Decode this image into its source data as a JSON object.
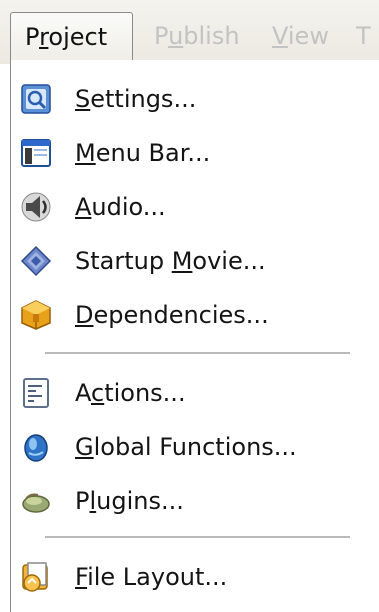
{
  "menubar": {
    "tabs": [
      {
        "label": "Project",
        "active": true
      },
      {
        "label": "Publish",
        "active": false
      },
      {
        "label": "View",
        "active": false
      },
      {
        "label": "T",
        "active": false
      }
    ]
  },
  "dropdown": {
    "items": [
      {
        "label": "Settings...",
        "mnemonic": "S",
        "icon": "settings-icon"
      },
      {
        "label": "Menu Bar...",
        "mnemonic": "M",
        "icon": "menu-bar-icon"
      },
      {
        "label": "Audio...",
        "mnemonic": "A",
        "icon": "speaker-icon"
      },
      {
        "label": "Startup Movie...",
        "mnemonic": "M",
        "icon": "startup-movie-icon"
      },
      {
        "label": "Dependencies...",
        "mnemonic": "D",
        "icon": "package-icon"
      },
      {
        "label": "Actions...",
        "mnemonic": "c",
        "icon": "actions-icon"
      },
      {
        "label": "Global Functions...",
        "mnemonic": "G",
        "icon": "globe-icon"
      },
      {
        "label": "Plugins...",
        "mnemonic": "l",
        "icon": "plugin-icon"
      },
      {
        "label": "File Layout...",
        "mnemonic": "F",
        "icon": "file-layout-icon"
      }
    ]
  }
}
